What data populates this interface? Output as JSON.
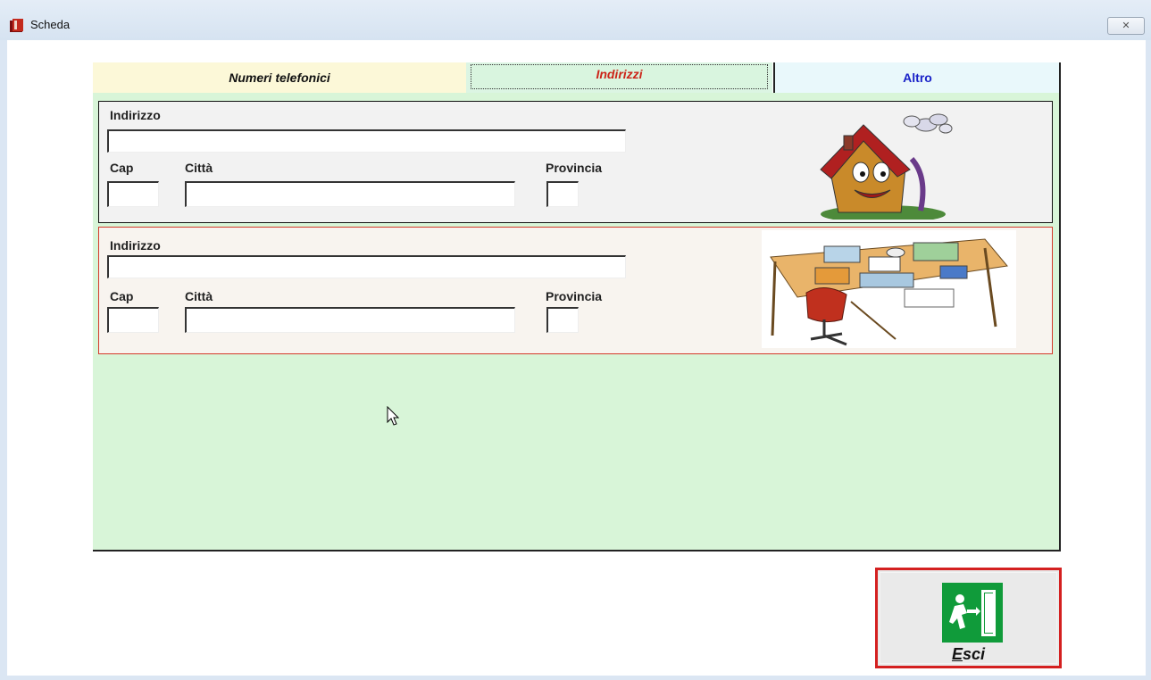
{
  "window": {
    "title": "Scheda",
    "close_glyph": "✕"
  },
  "tabs": [
    {
      "label": "Numeri telefonici",
      "color": "#111111"
    },
    {
      "label": "Indirizzi",
      "color": "#cc2418",
      "selected": true
    },
    {
      "label": "Altro",
      "color": "#1a22c8"
    }
  ],
  "address_blocks": [
    {
      "indirizzo_label": "Indirizzo",
      "indirizzo_value": "",
      "cap_label": "Cap",
      "cap_value": "",
      "citta_label": "Città",
      "citta_value": "",
      "provincia_label": "Provincia",
      "provincia_value": "",
      "image": "house-cartoon"
    },
    {
      "indirizzo_label": "Indirizzo",
      "indirizzo_value": "",
      "cap_label": "Cap",
      "cap_value": "",
      "citta_label": "Città",
      "citta_value": "",
      "provincia_label": "Provincia",
      "provincia_value": "",
      "image": "office-desk-cartoon"
    }
  ],
  "exit_button": {
    "label_first": "E",
    "label_rest": "sci",
    "icon": "emergency-exit-icon"
  },
  "colors": {
    "panel_bg": "#d8f5d8",
    "exit_border": "#d42020",
    "exit_icon_bg": "#109b3a"
  }
}
